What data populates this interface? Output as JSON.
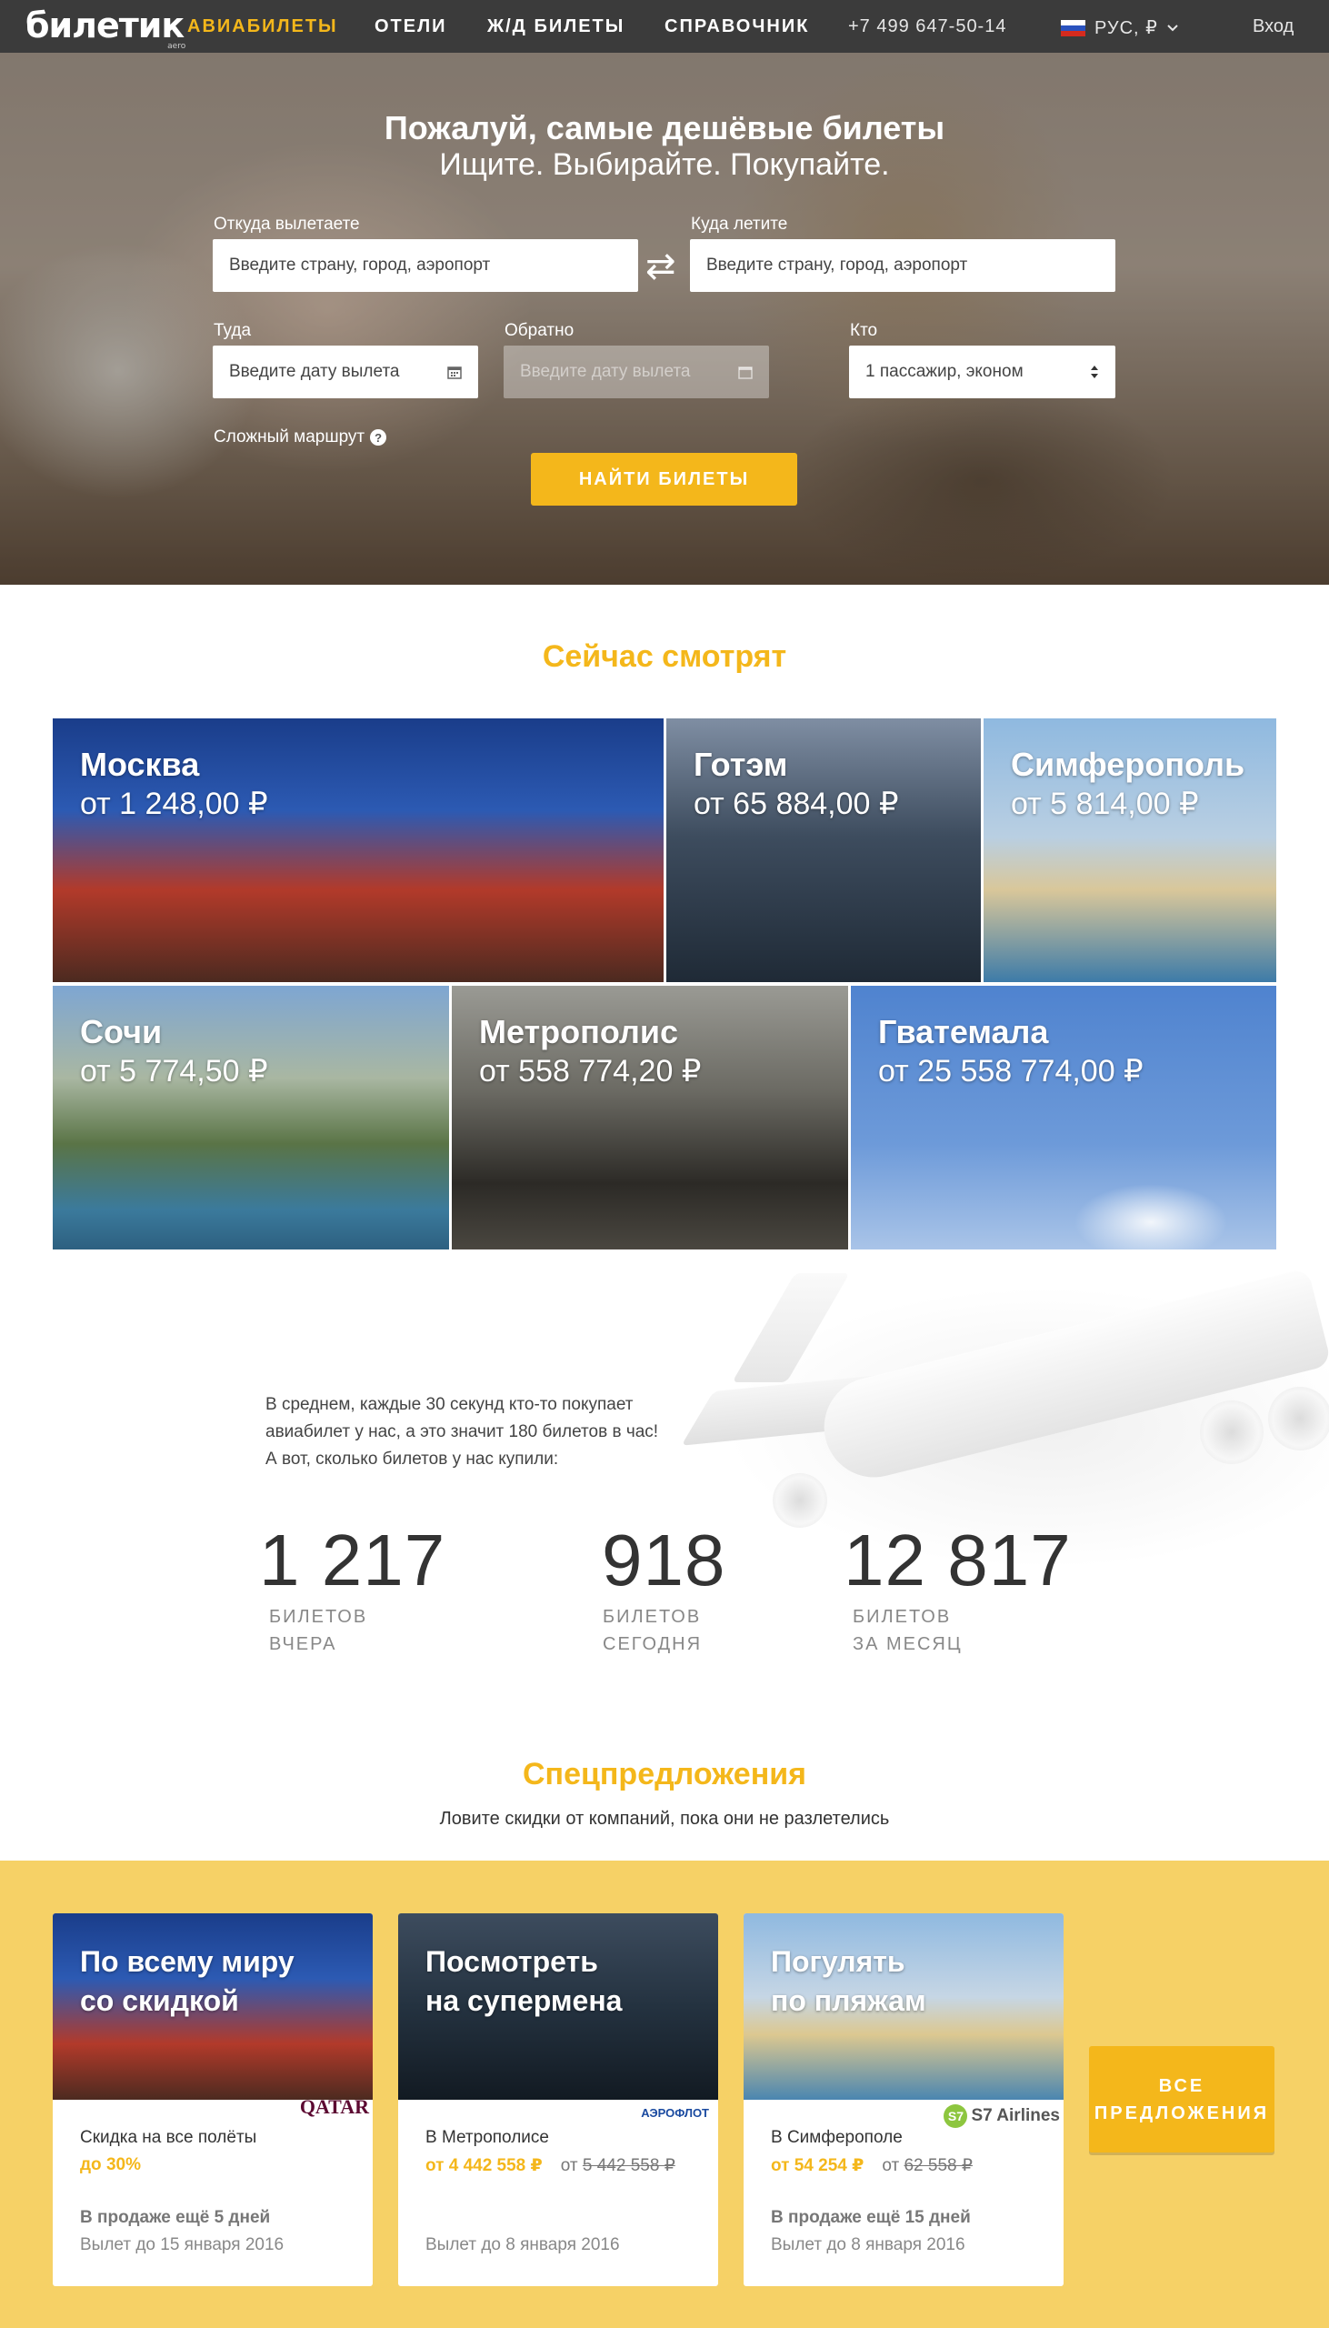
{
  "nav": {
    "logo": "билетик",
    "logo_sub": "aero",
    "items": [
      "АВИАБИЛЕТЫ",
      "ОТЕЛИ",
      "Ж/Д БИЛЕТЫ",
      "СПРАВОЧНИК"
    ],
    "phone": "+7 499 647-50-14",
    "lang": "РУС, ₽",
    "login": "Вход"
  },
  "hero": {
    "title": "Пожалуй, самые дешёвые билеты",
    "subtitle": "Ищите. Выбирайте. Покупайте.",
    "from_label": "Откуда вылетаете",
    "from_placeholder": "Введите страну, город, аэропорт",
    "to_label": "Куда летите",
    "to_placeholder": "Введите страну, город, аэропорт",
    "depart_label": "Туда",
    "depart_placeholder": "Введите дату вылета",
    "return_label": "Обратно",
    "return_placeholder": "Введите дату вылета",
    "who_label": "Кто",
    "who_value": "1 пассажир, эконом",
    "hard_route": "Сложный маршрут",
    "search_button": "НАЙТИ БИЛЕТЫ"
  },
  "watching": {
    "title": "Сейчас смотрят",
    "tiles": [
      {
        "name": "Москва",
        "price": "от 1 248,00 ₽"
      },
      {
        "name": "Готэм",
        "price": "от 65 884,00 ₽"
      },
      {
        "name": "Симферополь",
        "price": "от 5 814,00 ₽"
      },
      {
        "name": "Сочи",
        "price": "от 5 774,50 ₽"
      },
      {
        "name": "Метрополис",
        "price": "от 558 774,20 ₽"
      },
      {
        "name": "Гватемала",
        "price": "от 25 558 774,00 ₽"
      }
    ]
  },
  "stats": {
    "line1": "В среднем, каждые 30 секунд кто-то покупает",
    "line2": "авиабилет у нас, а это значит 180 билетов в час!",
    "line3": "А вот, сколько билетов у нас купили:",
    "items": [
      {
        "value": "1 217",
        "label1": "БИЛЕТОВ",
        "label2": "ВЧЕРА"
      },
      {
        "value": "918",
        "label1": "БИЛЕТОВ",
        "label2": "СЕГОДНЯ"
      },
      {
        "value": "12 817",
        "label1": "БИЛЕТОВ",
        "label2": "ЗА МЕСЯЦ"
      }
    ]
  },
  "offers": {
    "title": "Спецпредложения",
    "subtitle": "Ловите скидки от компаний, пока они не разлетелись",
    "cards": [
      {
        "title1": "По всему миру",
        "title2": "со скидкой",
        "airline": "QATAR",
        "line1": "Скидка на все полёты",
        "price": "до 30%",
        "old_prefix": "",
        "old_price": "",
        "remaining": "В продаже ещё 5 дней",
        "until": "Вылет до 15 января 2016"
      },
      {
        "title1": "Посмотреть",
        "title2": "на супермена",
        "airline": "АЭРОФЛОТ",
        "line1": "В Метрополисе",
        "price": "от 4 442 558 ₽",
        "old_prefix": "от",
        "old_price": "5 442 558 ₽",
        "remaining": "",
        "until": "Вылет до 8 января 2016"
      },
      {
        "title1": "Погулять",
        "title2": "по пляжам",
        "airline": "S7 Airlines",
        "line1": "В Симферополе",
        "price": "от 54 254 ₽",
        "old_prefix": "от",
        "old_price": "62 558 ₽",
        "remaining": "В продаже ещё 15 дней",
        "until": "Вылет до 8 января 2016"
      }
    ],
    "all_button1": "ВСЕ",
    "all_button2": "ПРЕДЛОЖЕНИЯ"
  },
  "colors": {
    "accent": "#f4b71b",
    "nav_bg": "#3b3b3b",
    "offers_bg": "#f6d166"
  }
}
